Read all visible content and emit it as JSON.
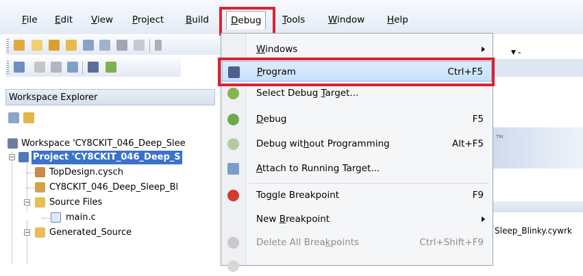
{
  "menubar": {
    "items": [
      {
        "label": "File",
        "u": "F",
        "rest": "ile"
      },
      {
        "label": "Edit",
        "u": "E",
        "rest": "dit"
      },
      {
        "label": "View",
        "u": "V",
        "rest": "iew"
      },
      {
        "label": "Project",
        "u": "P",
        "rest": "roject"
      },
      {
        "label": "Build",
        "u": "B",
        "rest": "uild"
      },
      {
        "label": "Debug",
        "u": "D",
        "rest": "ebug"
      },
      {
        "label": "Tools",
        "u": "T",
        "rest": "ools"
      },
      {
        "label": "Window",
        "u": "W",
        "rest": "indow"
      },
      {
        "label": "Help",
        "u": "H",
        "rest": "elp"
      }
    ]
  },
  "workspace_explorer": {
    "title": "Workspace Explorer",
    "tree": {
      "workspace": "Workspace 'CY8CKIT_046_Deep_Slee",
      "project": "Project  'CY8CKIT_046_Deep_S",
      "topdesign": "TopDesign.cysch",
      "cywrk": "CY8CKIT_046_Deep_Sleep_Bl",
      "source_files": "Source Files",
      "main_c": "main.c",
      "generated_source": "Generated_Source"
    }
  },
  "debug_menu": {
    "items": [
      {
        "pre": "",
        "u": "W",
        "post": "indows",
        "shortcut": "",
        "submenu": true,
        "disabled": false,
        "icon": ""
      },
      {
        "pre": "",
        "u": "P",
        "post": "rogram",
        "shortcut": "Ctrl+F5",
        "submenu": false,
        "disabled": false,
        "icon": "program-chip-icon"
      },
      {
        "pre": "Select Debug ",
        "u": "T",
        "post": "arget...",
        "shortcut": "",
        "submenu": false,
        "disabled": false,
        "icon": "select-target-bug-icon"
      },
      {
        "pre": "",
        "u": "D",
        "post": "ebug",
        "shortcut": "F5",
        "submenu": false,
        "disabled": false,
        "icon": "debug-bug-icon"
      },
      {
        "pre": "Debug wit",
        "u": "h",
        "post": "out Programming",
        "shortcut": "Alt+F5",
        "submenu": false,
        "disabled": false,
        "icon": "debug-no-program-bug-icon"
      },
      {
        "pre": "",
        "u": "A",
        "post": "ttach to Running Target...",
        "shortcut": "",
        "submenu": false,
        "disabled": false,
        "icon": "attach-target-icon"
      },
      {
        "pre": "To",
        "u": "g",
        "post": "gle Breakpoint",
        "shortcut": "F9",
        "submenu": false,
        "disabled": false,
        "icon": "breakpoint-icon"
      },
      {
        "pre": "New ",
        "u": "B",
        "post": "reakpoint",
        "shortcut": "",
        "submenu": true,
        "disabled": false,
        "icon": ""
      },
      {
        "pre": "Delete All Brea",
        "u": "k",
        "post": "points",
        "shortcut": "Ctrl+Shift+F9",
        "submenu": false,
        "disabled": true,
        "icon": "delete-breakpoints-icon"
      }
    ]
  },
  "editor": {
    "filename_tail": "Sleep_Blinky.cywrk",
    "tm": "TM"
  },
  "colors": {
    "highlight_red": "#e0202f",
    "selection_blue": "#3c73c8",
    "menu_hover": "#c6e0fb"
  }
}
